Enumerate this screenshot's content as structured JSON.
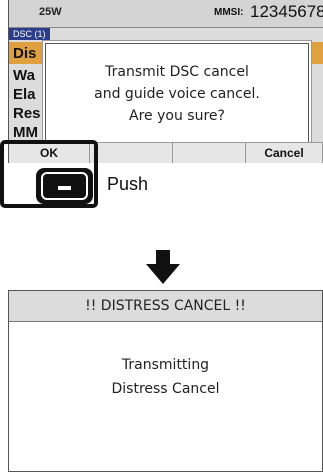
{
  "screen_top": {
    "status": {
      "power": "25W",
      "mmsi_label": "MMSI:",
      "mmsi_value": "12345678"
    },
    "tab": "DSC (1)",
    "background_rows": [
      "Dis",
      "Wa",
      "Ela",
      "Res",
      "MM"
    ],
    "dialog": {
      "lines": [
        "Transmit DSC cancel",
        "and guide voice cancel.",
        "Are you sure?"
      ]
    },
    "softkeys": {
      "ok": "OK",
      "cancel": "Cancel"
    },
    "colors": {
      "tab": "#2a3d8c",
      "header_row": "#e0a040",
      "screen_bg": "#dcdcdc"
    }
  },
  "push": {
    "label": "Push",
    "key_icon": "minus-key-icon"
  },
  "arrow": {
    "icon": "arrow-down-icon"
  },
  "screen_bottom": {
    "header": "!! DISTRESS CANCEL !!",
    "lines": [
      "Transmitting",
      "Distress Cancel"
    ]
  }
}
